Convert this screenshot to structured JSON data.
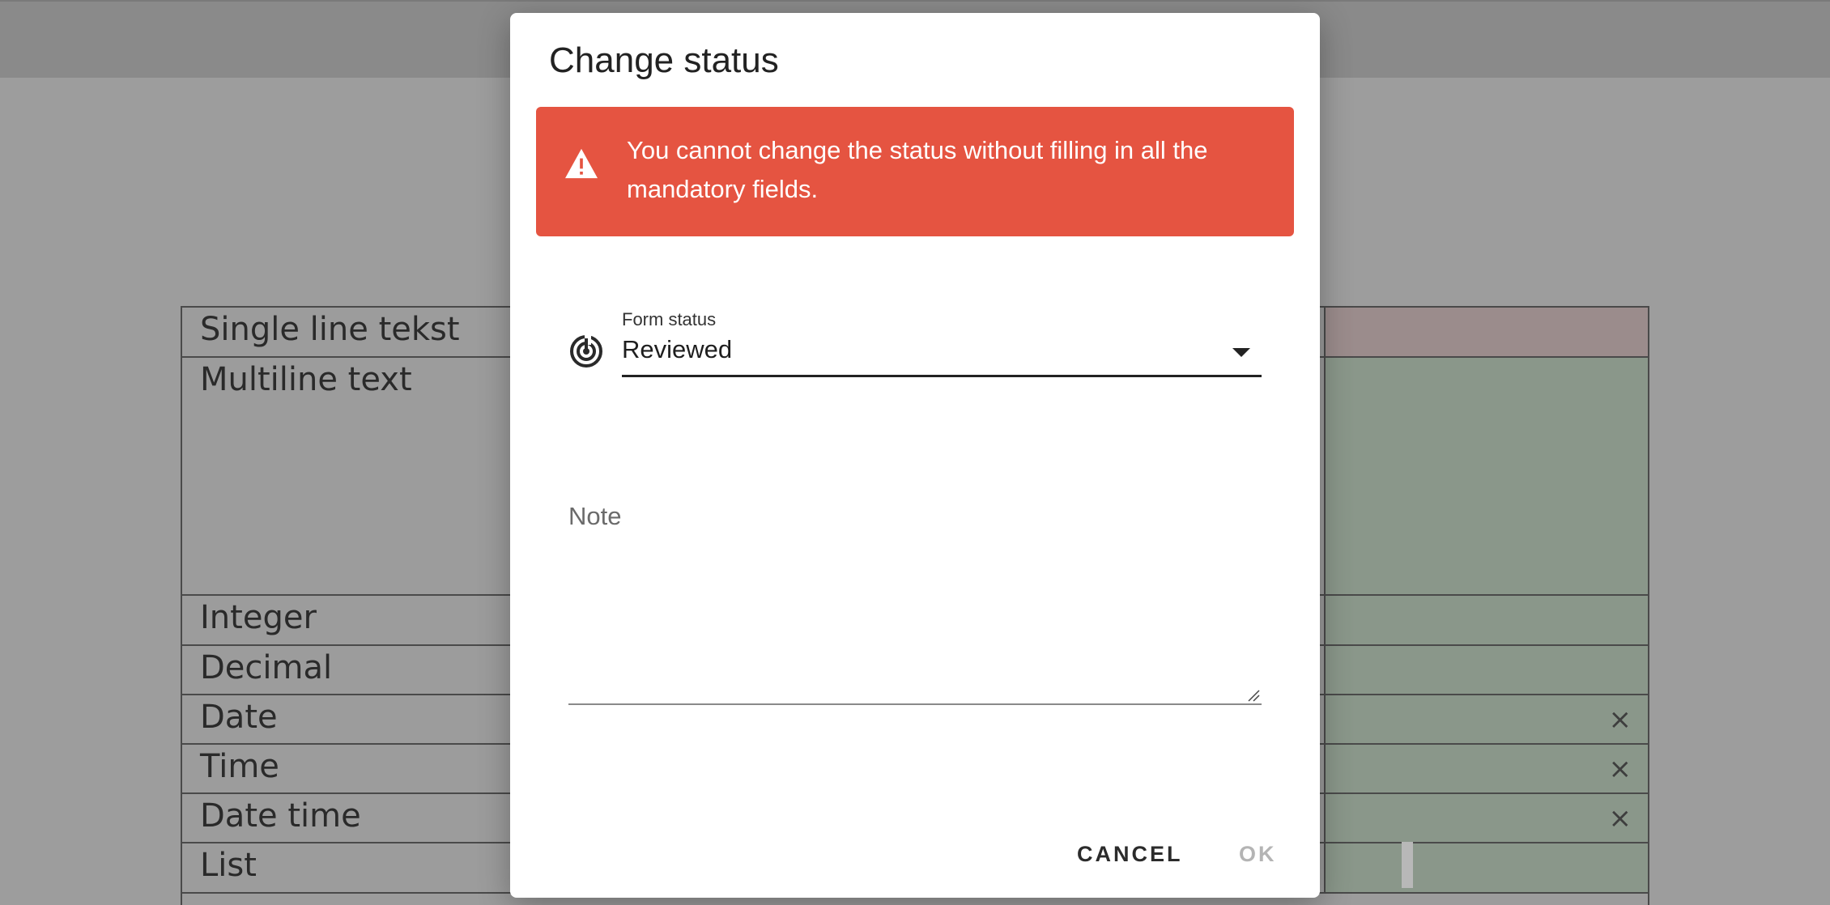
{
  "background_form": {
    "rows": [
      {
        "label": "Single line tekst"
      },
      {
        "label": "Multiline text"
      },
      {
        "label": "Integer"
      },
      {
        "label": "Decimal"
      },
      {
        "label": "Date",
        "clear": "×"
      },
      {
        "label": "Time",
        "clear": "×"
      },
      {
        "label": "Date time",
        "clear": "×"
      },
      {
        "label": "List"
      }
    ]
  },
  "dialog": {
    "title": "Change status",
    "error": {
      "icon": "warning-icon",
      "message": "You cannot change the status without filling in all the mandatory fields.",
      "color": "#e55441"
    },
    "status_field": {
      "icon": "status-icon",
      "label": "Form status",
      "value": "Reviewed"
    },
    "note_field": {
      "label": "Note",
      "value": ""
    },
    "actions": {
      "cancel_label": "CANCEL",
      "ok_label": "OK",
      "ok_enabled": false
    }
  }
}
